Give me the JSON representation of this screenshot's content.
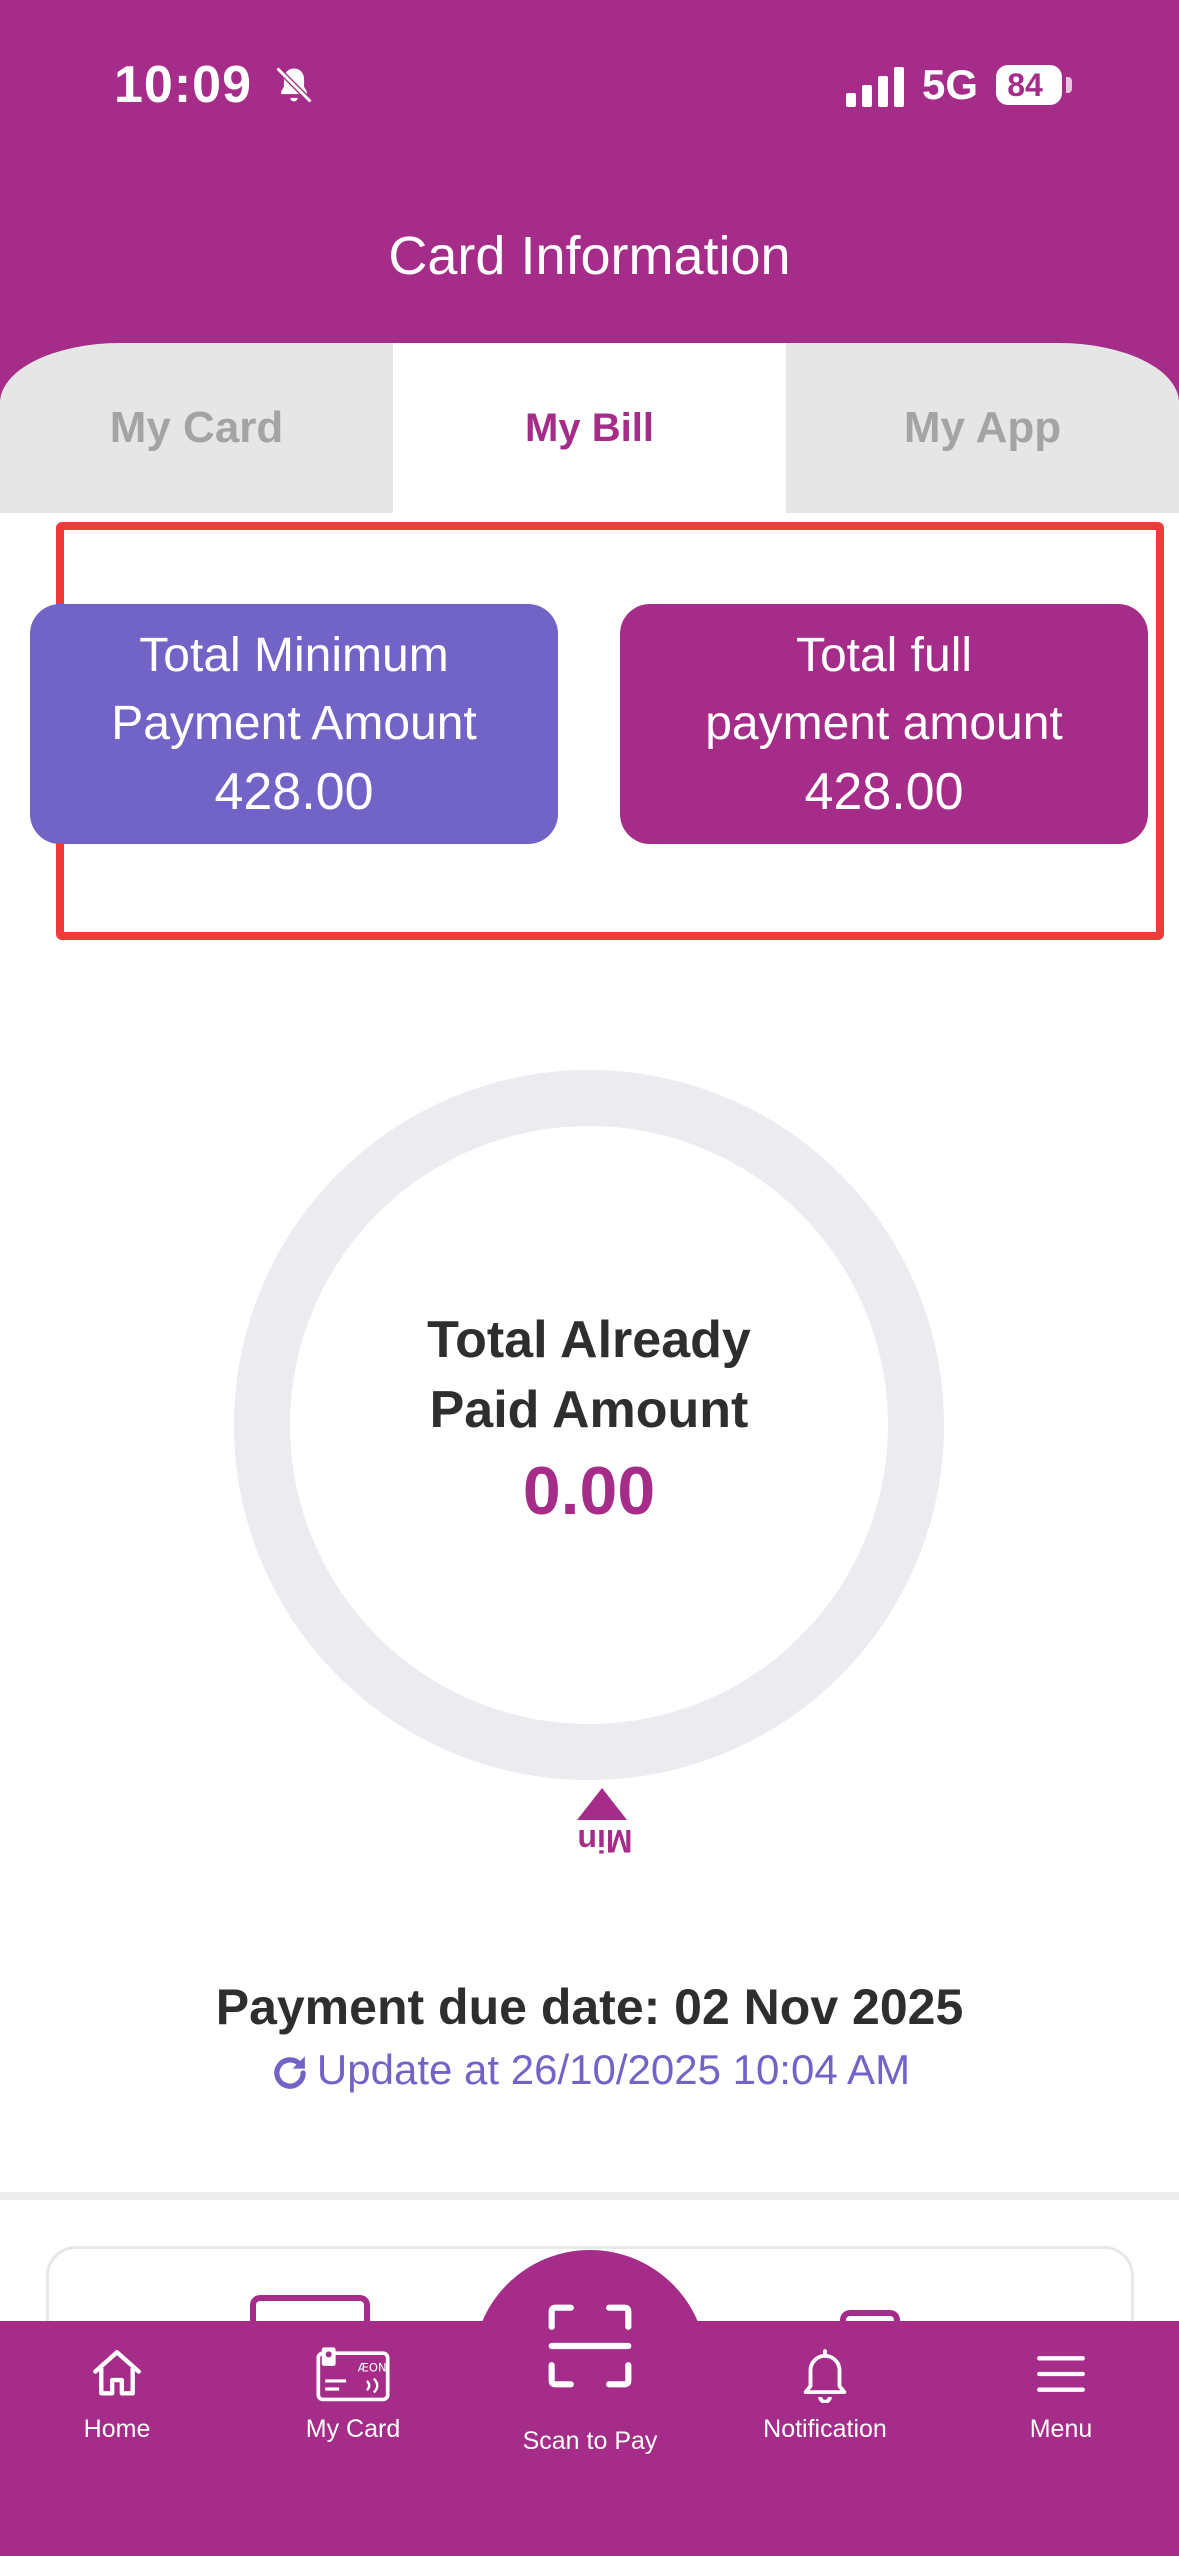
{
  "status_bar": {
    "time": "10:09",
    "network": "5G",
    "battery": "84"
  },
  "header": {
    "title": "Card Information"
  },
  "tabs": [
    {
      "label": "My Card"
    },
    {
      "label": "My Bill"
    },
    {
      "label": "My App"
    }
  ],
  "amounts": {
    "minimum": {
      "label_line1": "Total Minimum",
      "label_line2": "Payment Amount",
      "value": "428.00"
    },
    "full": {
      "label_line1": "Total full",
      "label_line2": "payment amount",
      "value": "428.00"
    }
  },
  "paid": {
    "label_line1": "Total Already",
    "label_line2": "Paid Amount",
    "value": "0.00",
    "progress_fraction": 0
  },
  "marker": {
    "label": "Min"
  },
  "due": {
    "text": "Payment due date: 02 Nov 2025",
    "update_text": "Update at 26/10/2025 10:04 AM"
  },
  "nav": [
    {
      "label": "Home",
      "icon": "home-icon"
    },
    {
      "label": "My Card",
      "icon": "card-icon"
    },
    {
      "label": "Scan to Pay",
      "icon": "scan-icon"
    },
    {
      "label": "Notification",
      "icon": "bell-icon"
    },
    {
      "label": "Menu",
      "icon": "menu-icon"
    }
  ],
  "colors": {
    "brand": "#a52c88",
    "accent": "#7263c7",
    "highlight": "#f03a3a"
  }
}
